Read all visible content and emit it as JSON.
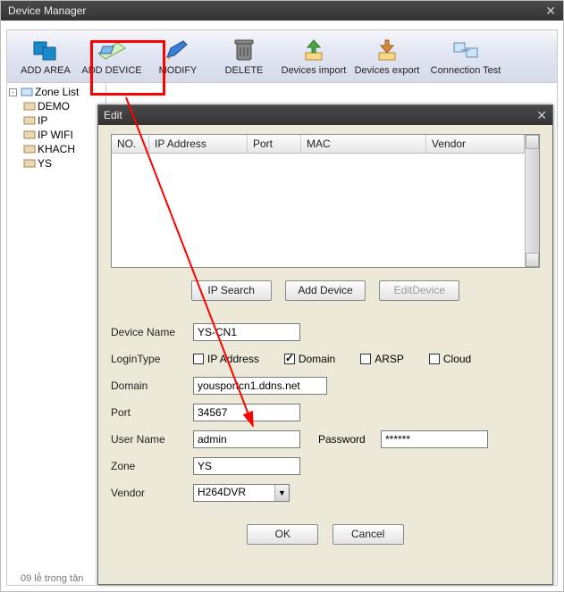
{
  "window": {
    "title": "Device Manager"
  },
  "toolbar": {
    "items": [
      {
        "label": "ADD AREA",
        "icon": "add-area-icon"
      },
      {
        "label": "ADD DEVICE",
        "icon": "add-device-icon",
        "highlighted": true
      },
      {
        "label": "MODIFY",
        "icon": "modify-icon"
      },
      {
        "label": "DELETE",
        "icon": "delete-icon"
      },
      {
        "label": "Devices import",
        "icon": "import-icon"
      },
      {
        "label": "Devices export",
        "icon": "export-icon"
      },
      {
        "label": "Connection Test",
        "icon": "connection-test-icon"
      }
    ]
  },
  "tree": {
    "root": "Zone List",
    "children": [
      "DEMO",
      "IP",
      "IP WIFI",
      "KHACH",
      "YS"
    ]
  },
  "dialog": {
    "title": "Edit",
    "table": {
      "columns": [
        "NO.",
        "IP Address",
        "Port",
        "MAC",
        "Vendor"
      ],
      "rows": []
    },
    "buttons": {
      "ip_search": "IP Search",
      "add_device": "Add Device",
      "edit_device": "EditDevice"
    },
    "form": {
      "device_name_label": "Device Name",
      "device_name": "YS-CN1",
      "login_type_label": "LoginType",
      "login_type_options": {
        "ip_address": {
          "label": "IP Address",
          "checked": false
        },
        "domain": {
          "label": "Domain",
          "checked": true
        },
        "arsp": {
          "label": "ARSP",
          "checked": false
        },
        "cloud": {
          "label": "Cloud",
          "checked": false
        }
      },
      "domain_label": "Domain",
      "domain": "yousportcn1.ddns.net",
      "port_label": "Port",
      "port": "34567",
      "user_name_label": "User Name",
      "user_name": "admin",
      "password_label": "Password",
      "password": "******",
      "zone_label": "Zone",
      "zone": "YS",
      "vendor_label": "Vendor",
      "vendor": "H264DVR"
    },
    "ok": "OK",
    "cancel": "Cancel"
  },
  "bottom_hint": "09 lễ trong tản"
}
